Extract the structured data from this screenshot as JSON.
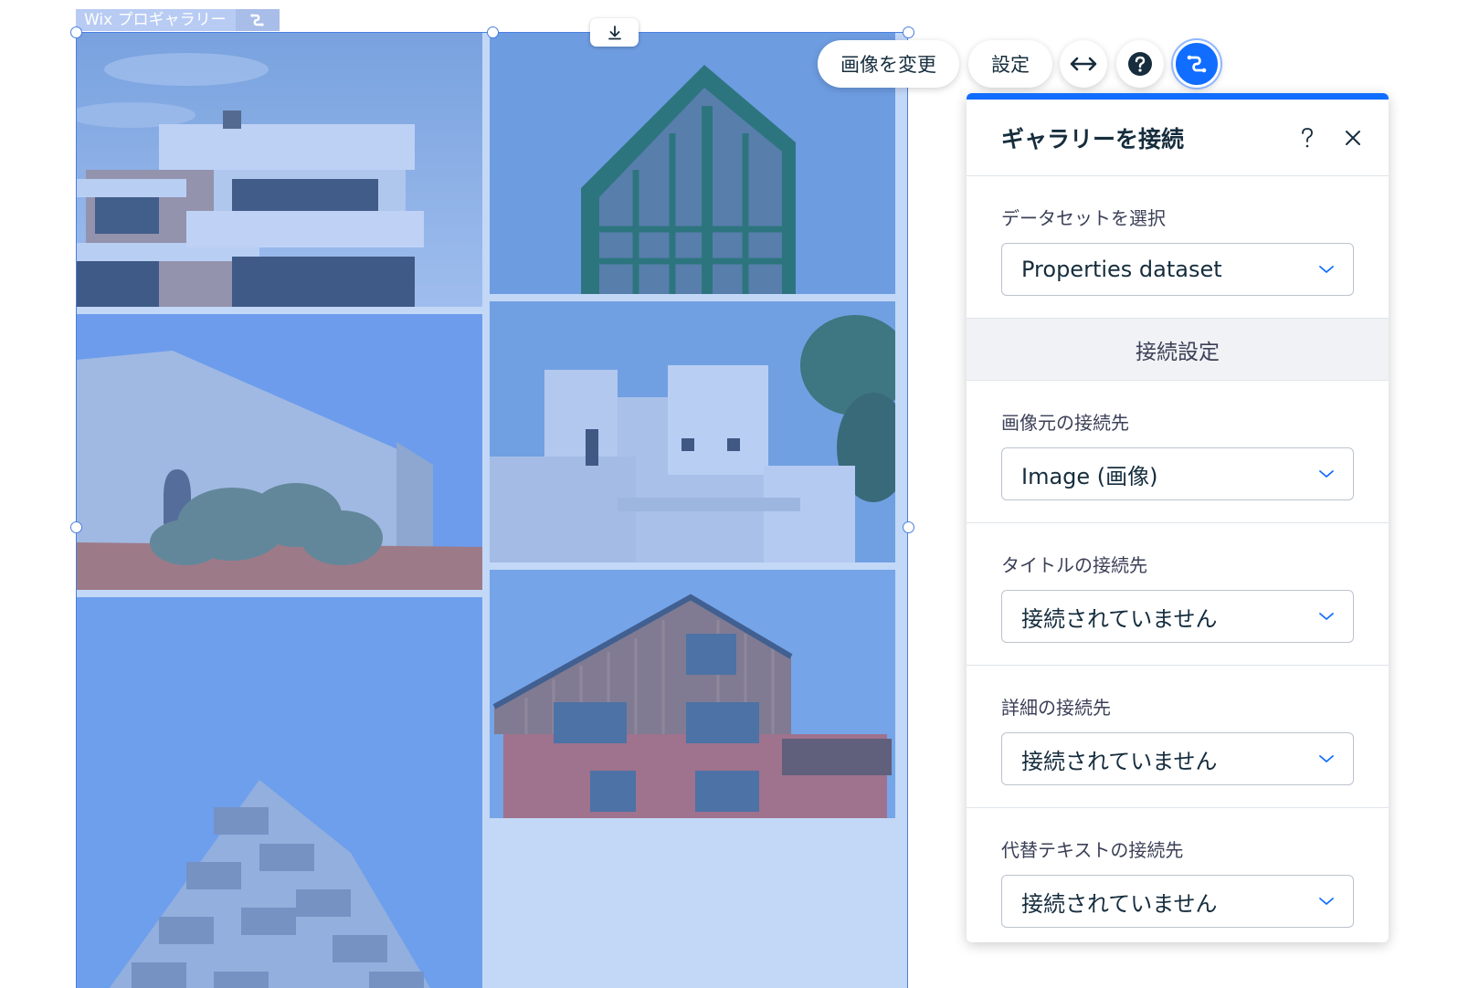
{
  "gallery": {
    "tag_label": "Wix プロギャラリー",
    "tiles": [
      {
        "name": "modern-white-villa"
      },
      {
        "name": "green-frame-tower"
      },
      {
        "name": "white-wall-olive-tree"
      },
      {
        "name": "white-cubic-house"
      },
      {
        "name": "balcony-tower"
      },
      {
        "name": "wood-brick-house"
      }
    ]
  },
  "toolbar": {
    "change_image": "画像を変更",
    "settings": "設定",
    "icons": [
      "stretch-arrows-icon",
      "help-icon",
      "connect-data-icon"
    ]
  },
  "panel": {
    "title": "ギャラリーを接続",
    "dataset_label": "データセットを選択",
    "dataset_value": "Properties dataset",
    "connection_settings": "接続設定",
    "fields": [
      {
        "label": "画像元の接続先",
        "value": "Image (画像)"
      },
      {
        "label": "タイトルの接続先",
        "value": "接続されていません"
      },
      {
        "label": "詳細の接続先",
        "value": "接続されていません"
      },
      {
        "label": "代替テキストの接続先",
        "value": "接続されていません"
      }
    ]
  },
  "colors": {
    "accent": "#116dff",
    "selection": "#4a7fe0",
    "text": "#162d3d"
  }
}
